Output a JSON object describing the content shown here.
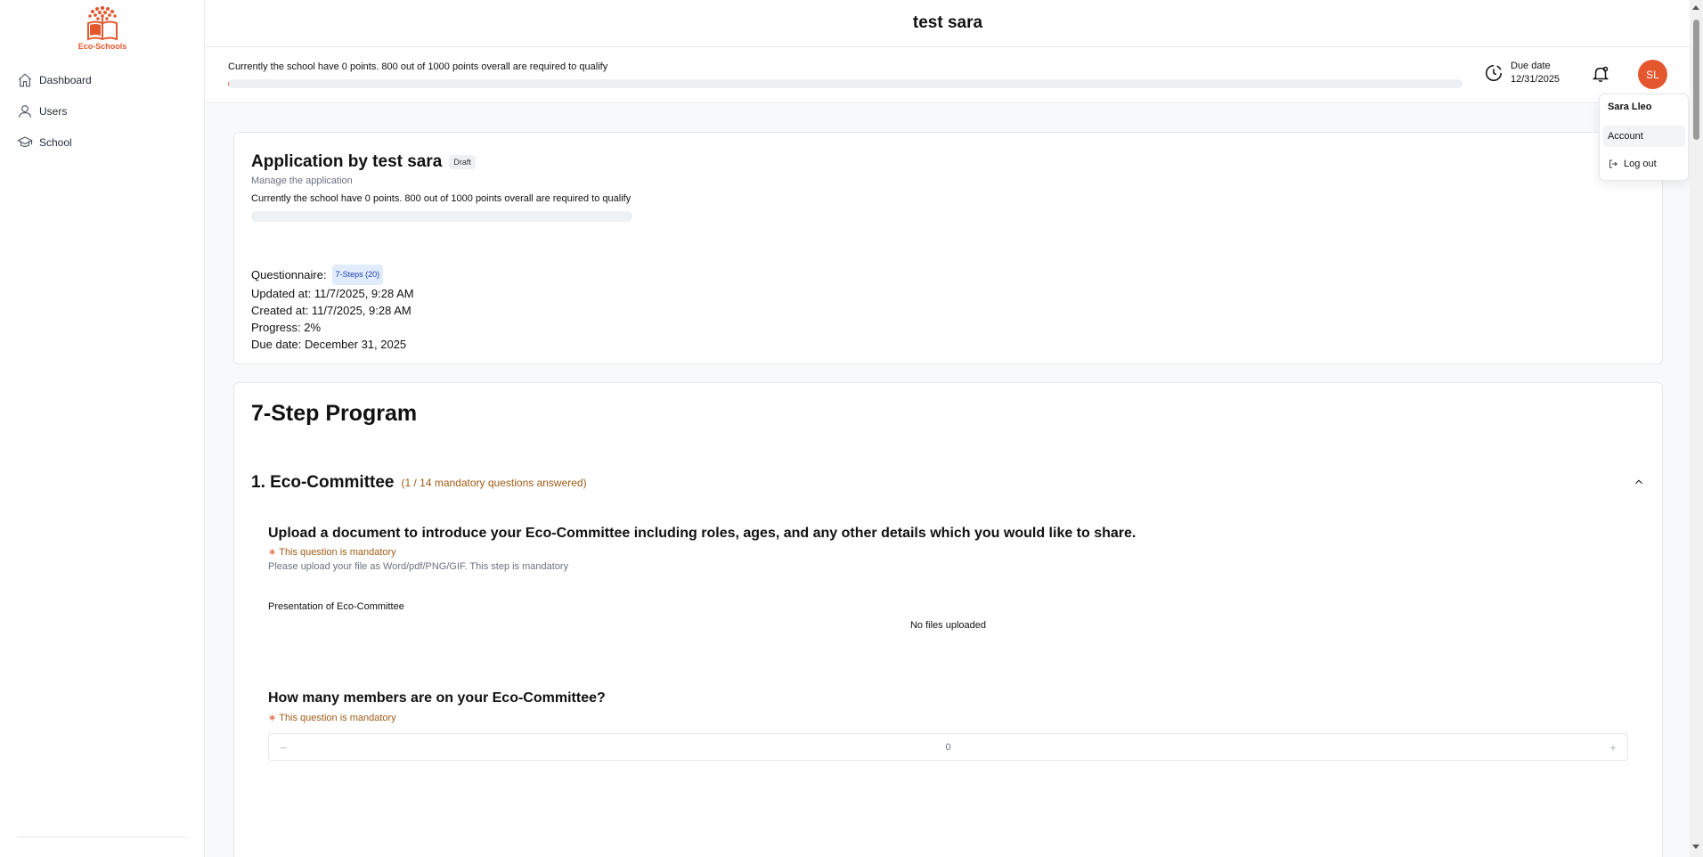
{
  "sidebar": {
    "logo_text": "Eco-Schools",
    "items": [
      {
        "label": "Dashboard",
        "icon": "home-icon"
      },
      {
        "label": "Users",
        "icon": "user-icon"
      },
      {
        "label": "School",
        "icon": "graduation-cap-icon"
      }
    ]
  },
  "header": {
    "title": "test sara",
    "points_text": "Currently the school have 0 points. 800 out of 1000 points overall are required to qualify",
    "points_progress": 0.001,
    "due_label": "Due date",
    "due_value": "12/31/2025",
    "avatar_initials": "SL"
  },
  "user_menu": {
    "name": "Sara Lleo",
    "account": "Account",
    "logout": "Log out"
  },
  "application": {
    "title": "Application by test sara",
    "status": "Draft",
    "subtitle": "Manage the application",
    "points_text": "Currently the school have 0 points. 800 out of 1000 points overall are required to qualify",
    "questionnaire_label": "Questionnaire:",
    "questionnaire_badge": "7-Steps (20)",
    "updated": "Updated at: 11/7/2025, 9:28 AM",
    "created": "Created at: 11/7/2025, 9:28 AM",
    "progress": "Progress: 2%",
    "due": "Due date: December 31, 2025"
  },
  "program": {
    "title": "7-Step Program",
    "step": {
      "title": "1. Eco-Committee",
      "count": "(1 / 14 mandatory questions answered)"
    },
    "questions": [
      {
        "title": "Upload a document to introduce your Eco-Committee including roles, ages, and any other details which you would like to share.",
        "mandatory": "This question is mandatory",
        "hint": "Please upload your file as Word/pdf/PNG/GIF. This step is mandatory",
        "field_label": "Presentation of Eco-Committee",
        "empty_text": "No files uploaded"
      },
      {
        "title": "How many members are on your Eco-Committee?",
        "mandatory": "This question is mandatory",
        "value": "0",
        "minus": "−",
        "plus": "+"
      }
    ]
  },
  "colors": {
    "accent": "#e4572e",
    "mandatory": "#a15c17",
    "badge_blue": "#1e40af"
  }
}
